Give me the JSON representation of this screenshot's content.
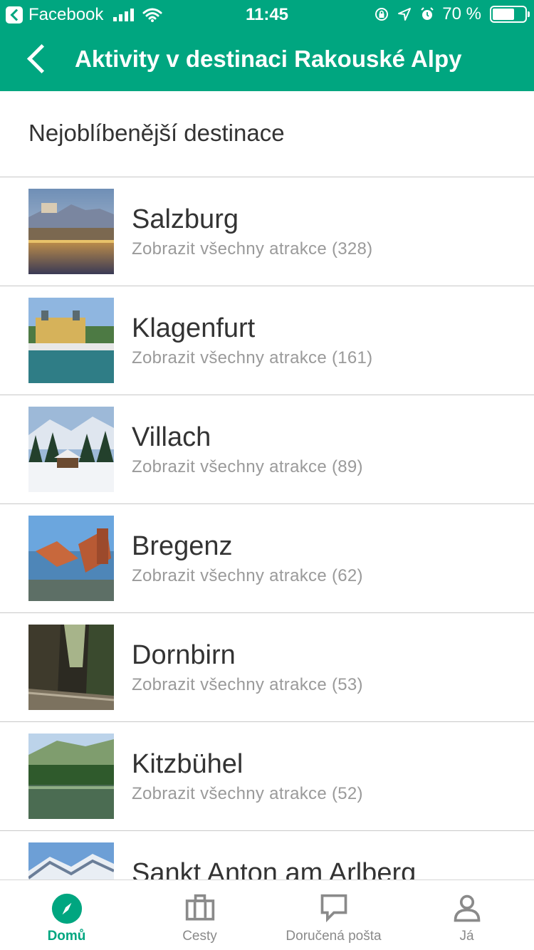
{
  "status_bar": {
    "app": "Facebook",
    "time": "11:45",
    "battery": "70 %",
    "battery_level": 0.7
  },
  "header": {
    "title": "Aktivity v destinaci Rakouské Alpy",
    "back_icon": "chevron-left-icon"
  },
  "section": {
    "title": "Nejoblíbenější destinace"
  },
  "destinations": [
    {
      "name": "Salzburg",
      "sub": "Zobrazit všechny atrakce (328)"
    },
    {
      "name": "Klagenfurt",
      "sub": "Zobrazit všechny atrakce (161)"
    },
    {
      "name": "Villach",
      "sub": "Zobrazit všechny atrakce (89)"
    },
    {
      "name": "Bregenz",
      "sub": "Zobrazit všechny atrakce (62)"
    },
    {
      "name": "Dornbirn",
      "sub": "Zobrazit všechny atrakce (53)"
    },
    {
      "name": "Kitzbühel",
      "sub": "Zobrazit všechny atrakce (52)"
    },
    {
      "name": "Sankt Anton am Arlberg",
      "sub": ""
    }
  ],
  "tabs": [
    {
      "label": "Domů",
      "icon": "compass-icon",
      "active": true
    },
    {
      "label": "Cesty",
      "icon": "briefcase-icon",
      "active": false
    },
    {
      "label": "Doručená pošta",
      "icon": "chat-bubble-icon",
      "active": false
    },
    {
      "label": "Já",
      "icon": "person-icon",
      "active": false
    }
  ],
  "colors": {
    "brand": "#00a680",
    "text": "#333333",
    "subtext": "#9a9a9a",
    "divider": "#c8c8c8"
  }
}
